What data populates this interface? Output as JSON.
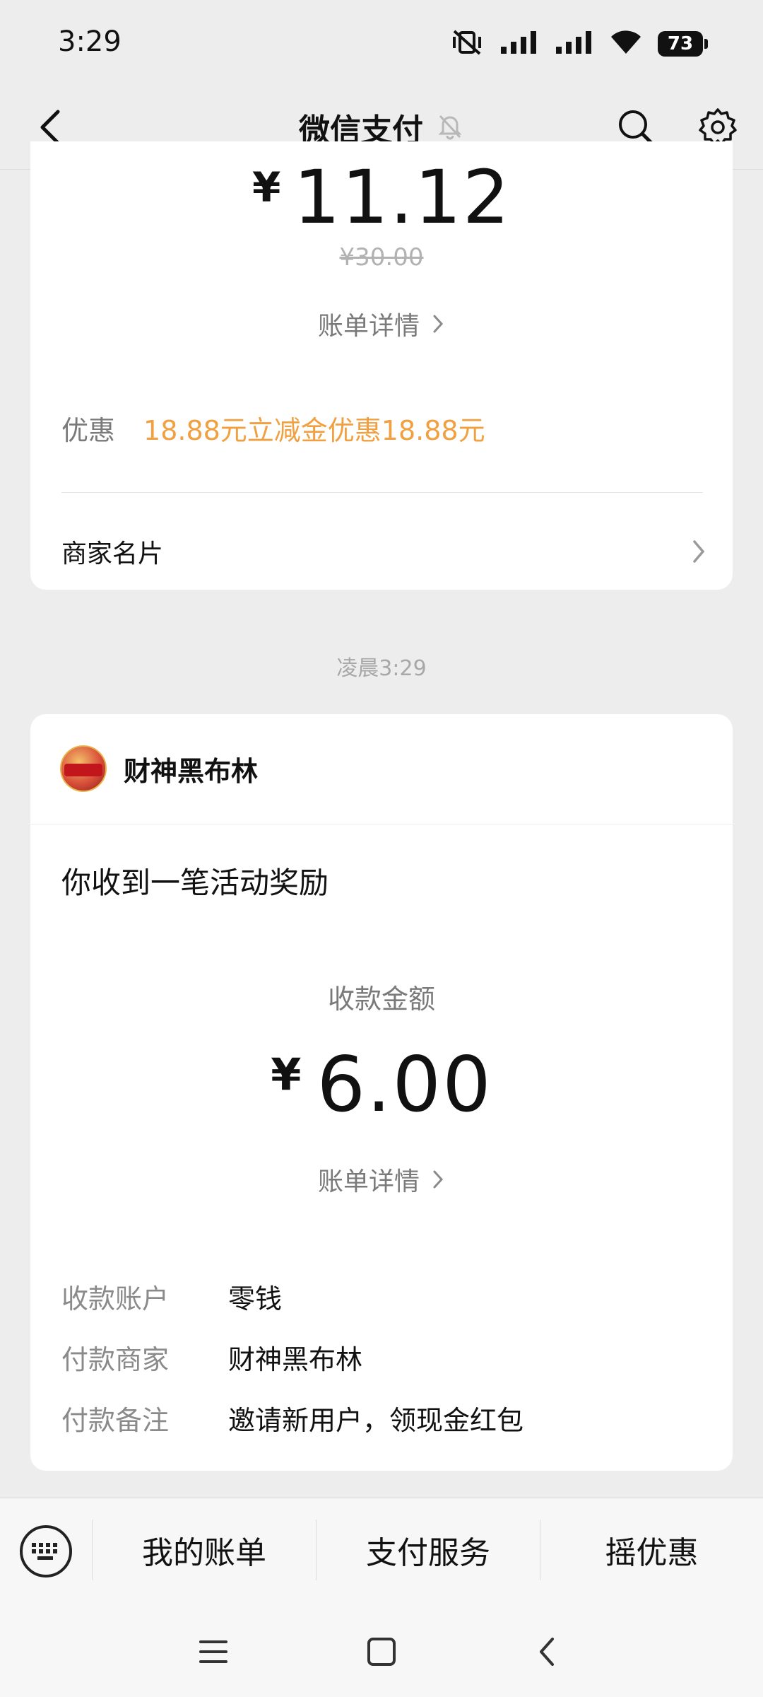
{
  "status_bar": {
    "time": "3:29",
    "battery": "73"
  },
  "header": {
    "title": "微信支付"
  },
  "payment_card": {
    "yen": "¥",
    "amount": "11.12",
    "original_price": "¥30.00",
    "bill_detail": "账单详情",
    "discount_label": "优惠",
    "discount_value": "18.88元立减金优惠18.88元",
    "merchant_card": "商家名片"
  },
  "timestamp": "凌晨3:29",
  "reward_card": {
    "sender": "财神黑布林",
    "title": "你收到一笔活动奖励",
    "amount_label": "收款金额",
    "yen": "¥",
    "amount": "6.00",
    "bill_detail": "账单详情",
    "rows": [
      {
        "label": "收款账户",
        "value": "零钱"
      },
      {
        "label": "付款商家",
        "value": "财神黑布林"
      },
      {
        "label": "付款备注",
        "value": "邀请新用户，领现金红包"
      }
    ]
  },
  "tab_bar": {
    "tabs": [
      "我的账单",
      "支付服务",
      "摇优惠"
    ]
  },
  "colors": {
    "background": "#ededed",
    "discount": "#f0a040",
    "muted": "#7a7a7a"
  }
}
